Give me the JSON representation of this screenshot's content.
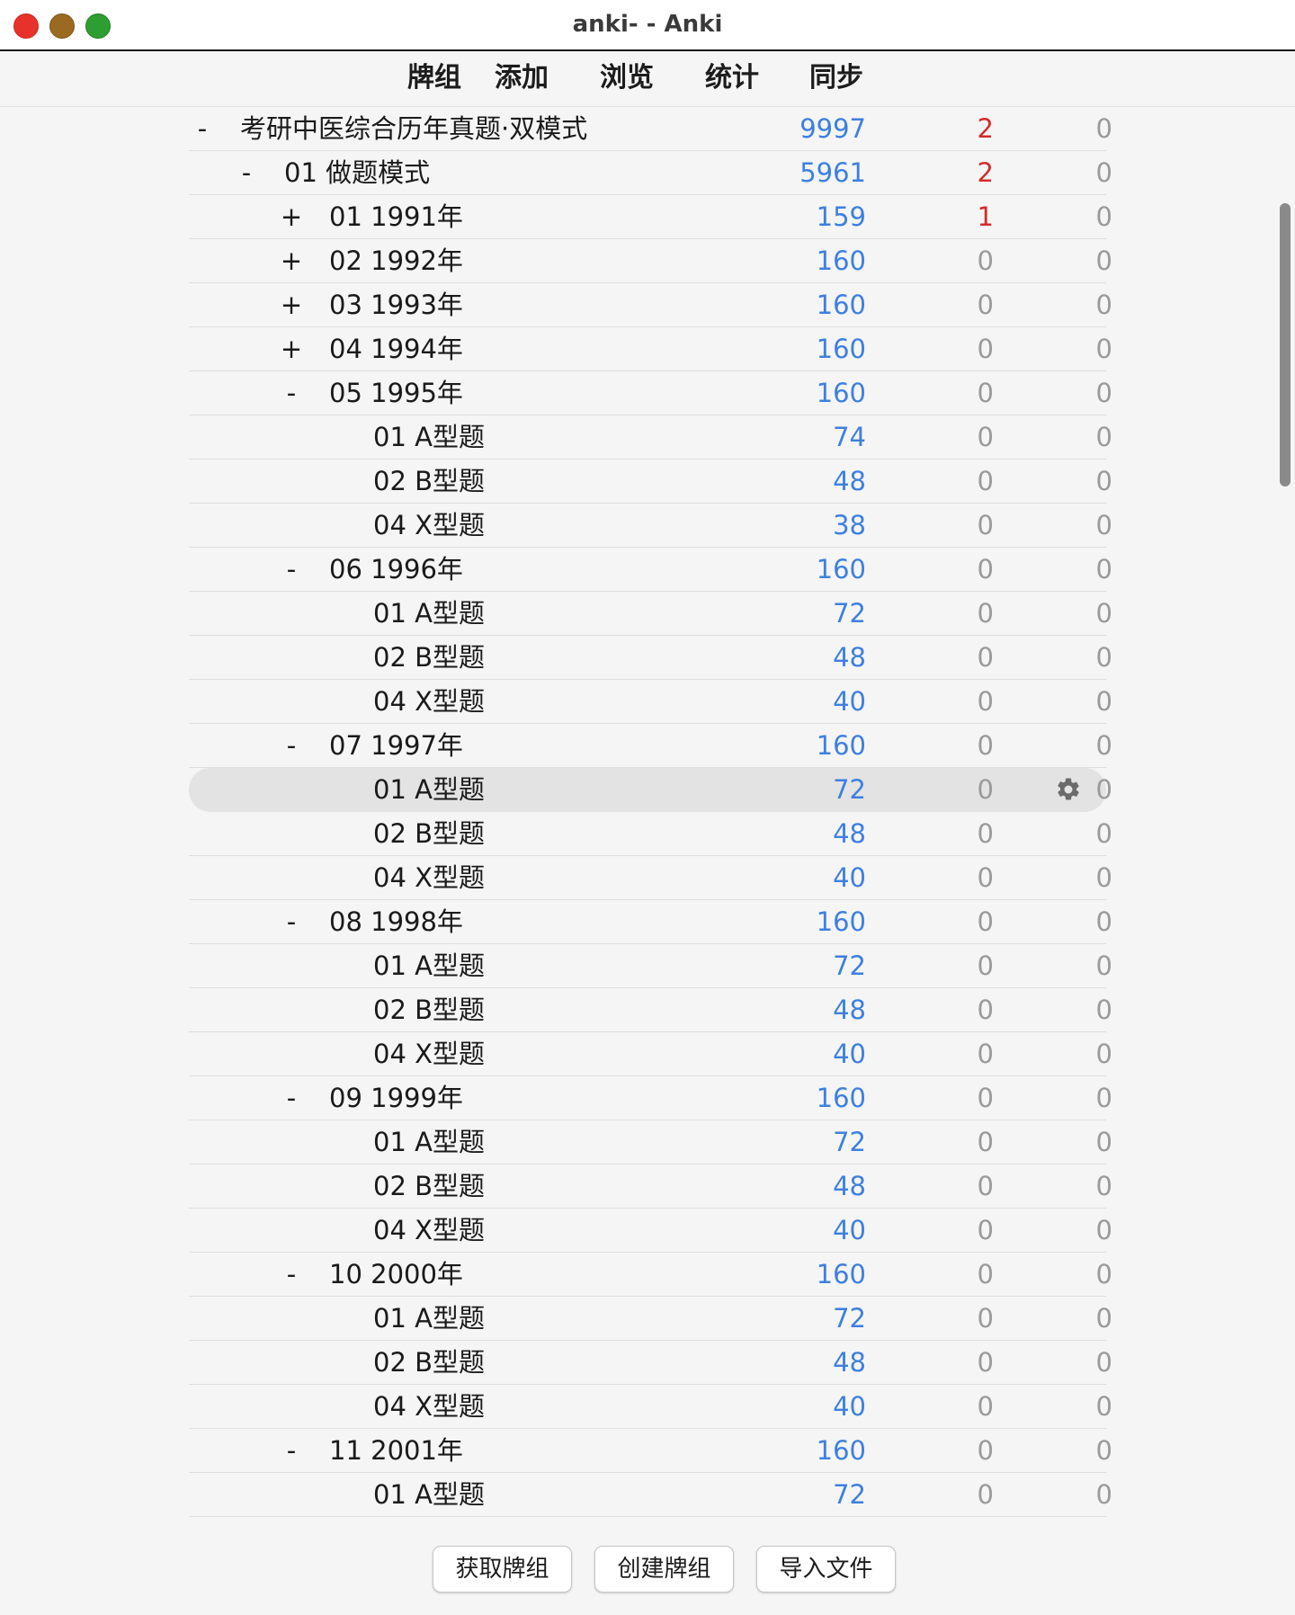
{
  "window": {
    "title": "anki- - Anki"
  },
  "toolbar": {
    "items": [
      {
        "label": "牌组",
        "name": "toolbar-decks"
      },
      {
        "label": "添加",
        "name": "toolbar-add"
      },
      {
        "label": "浏览",
        "name": "toolbar-browse"
      },
      {
        "label": "统计",
        "name": "toolbar-stats"
      },
      {
        "label": "同步",
        "name": "toolbar-sync"
      }
    ]
  },
  "decks": {
    "rows": [
      {
        "level": 0,
        "toggle": "-",
        "name": "考研中医综合历年真题·双模式",
        "new": "9997",
        "learn": "2",
        "due": "0",
        "learn_highlight": true
      },
      {
        "level": 1,
        "toggle": "-",
        "name": "01 做题模式",
        "new": "5961",
        "learn": "2",
        "due": "0",
        "learn_highlight": true
      },
      {
        "level": 2,
        "toggle": "+",
        "name": "01 1991年",
        "new": "159",
        "learn": "1",
        "due": "0",
        "learn_highlight": true
      },
      {
        "level": 2,
        "toggle": "+",
        "name": "02 1992年",
        "new": "160",
        "learn": "0",
        "due": "0"
      },
      {
        "level": 2,
        "toggle": "+",
        "name": "03 1993年",
        "new": "160",
        "learn": "0",
        "due": "0"
      },
      {
        "level": 2,
        "toggle": "+",
        "name": "04 1994年",
        "new": "160",
        "learn": "0",
        "due": "0"
      },
      {
        "level": 2,
        "toggle": "-",
        "name": "05 1995年",
        "new": "160",
        "learn": "0",
        "due": "0"
      },
      {
        "level": 3,
        "toggle": "",
        "name": "01 A型题",
        "new": "74",
        "learn": "0",
        "due": "0"
      },
      {
        "level": 3,
        "toggle": "",
        "name": "02 B型题",
        "new": "48",
        "learn": "0",
        "due": "0"
      },
      {
        "level": 3,
        "toggle": "",
        "name": "04 X型题",
        "new": "38",
        "learn": "0",
        "due": "0"
      },
      {
        "level": 2,
        "toggle": "-",
        "name": "06 1996年",
        "new": "160",
        "learn": "0",
        "due": "0"
      },
      {
        "level": 3,
        "toggle": "",
        "name": "01 A型题",
        "new": "72",
        "learn": "0",
        "due": "0"
      },
      {
        "level": 3,
        "toggle": "",
        "name": "02 B型题",
        "new": "48",
        "learn": "0",
        "due": "0"
      },
      {
        "level": 3,
        "toggle": "",
        "name": "04 X型题",
        "new": "40",
        "learn": "0",
        "due": "0"
      },
      {
        "level": 2,
        "toggle": "-",
        "name": "07 1997年",
        "new": "160",
        "learn": "0",
        "due": "0"
      },
      {
        "level": 3,
        "toggle": "",
        "name": "01 A型题",
        "new": "72",
        "learn": "0",
        "due": "0",
        "current": true
      },
      {
        "level": 3,
        "toggle": "",
        "name": "02 B型题",
        "new": "48",
        "learn": "0",
        "due": "0"
      },
      {
        "level": 3,
        "toggle": "",
        "name": "04 X型题",
        "new": "40",
        "learn": "0",
        "due": "0"
      },
      {
        "level": 2,
        "toggle": "-",
        "name": "08 1998年",
        "new": "160",
        "learn": "0",
        "due": "0"
      },
      {
        "level": 3,
        "toggle": "",
        "name": "01 A型题",
        "new": "72",
        "learn": "0",
        "due": "0"
      },
      {
        "level": 3,
        "toggle": "",
        "name": "02 B型题",
        "new": "48",
        "learn": "0",
        "due": "0"
      },
      {
        "level": 3,
        "toggle": "",
        "name": "04 X型题",
        "new": "40",
        "learn": "0",
        "due": "0"
      },
      {
        "level": 2,
        "toggle": "-",
        "name": "09 1999年",
        "new": "160",
        "learn": "0",
        "due": "0"
      },
      {
        "level": 3,
        "toggle": "",
        "name": "01 A型题",
        "new": "72",
        "learn": "0",
        "due": "0"
      },
      {
        "level": 3,
        "toggle": "",
        "name": "02 B型题",
        "new": "48",
        "learn": "0",
        "due": "0"
      },
      {
        "level": 3,
        "toggle": "",
        "name": "04 X型题",
        "new": "40",
        "learn": "0",
        "due": "0"
      },
      {
        "level": 2,
        "toggle": "-",
        "name": "10 2000年",
        "new": "160",
        "learn": "0",
        "due": "0"
      },
      {
        "level": 3,
        "toggle": "",
        "name": "01 A型题",
        "new": "72",
        "learn": "0",
        "due": "0"
      },
      {
        "level": 3,
        "toggle": "",
        "name": "02 B型题",
        "new": "48",
        "learn": "0",
        "due": "0"
      },
      {
        "level": 3,
        "toggle": "",
        "name": "04 X型题",
        "new": "40",
        "learn": "0",
        "due": "0"
      },
      {
        "level": 2,
        "toggle": "-",
        "name": "11 2001年",
        "new": "160",
        "learn": "0",
        "due": "0"
      },
      {
        "level": 3,
        "toggle": "",
        "name": "01 A型题",
        "new": "72",
        "learn": "0",
        "due": "0"
      }
    ],
    "options_icon": "gear-icon"
  },
  "bottom_bar": {
    "buttons": [
      {
        "label": "获取牌组",
        "name": "get-shared-button"
      },
      {
        "label": "创建牌组",
        "name": "create-deck-button"
      },
      {
        "label": "导入文件",
        "name": "import-file-button"
      }
    ]
  },
  "colors": {
    "new_count": "#3d80e0",
    "learn_count_active": "#d42b2b",
    "zero_count": "#9a9a9a",
    "current_row": "#e3e3e3"
  }
}
